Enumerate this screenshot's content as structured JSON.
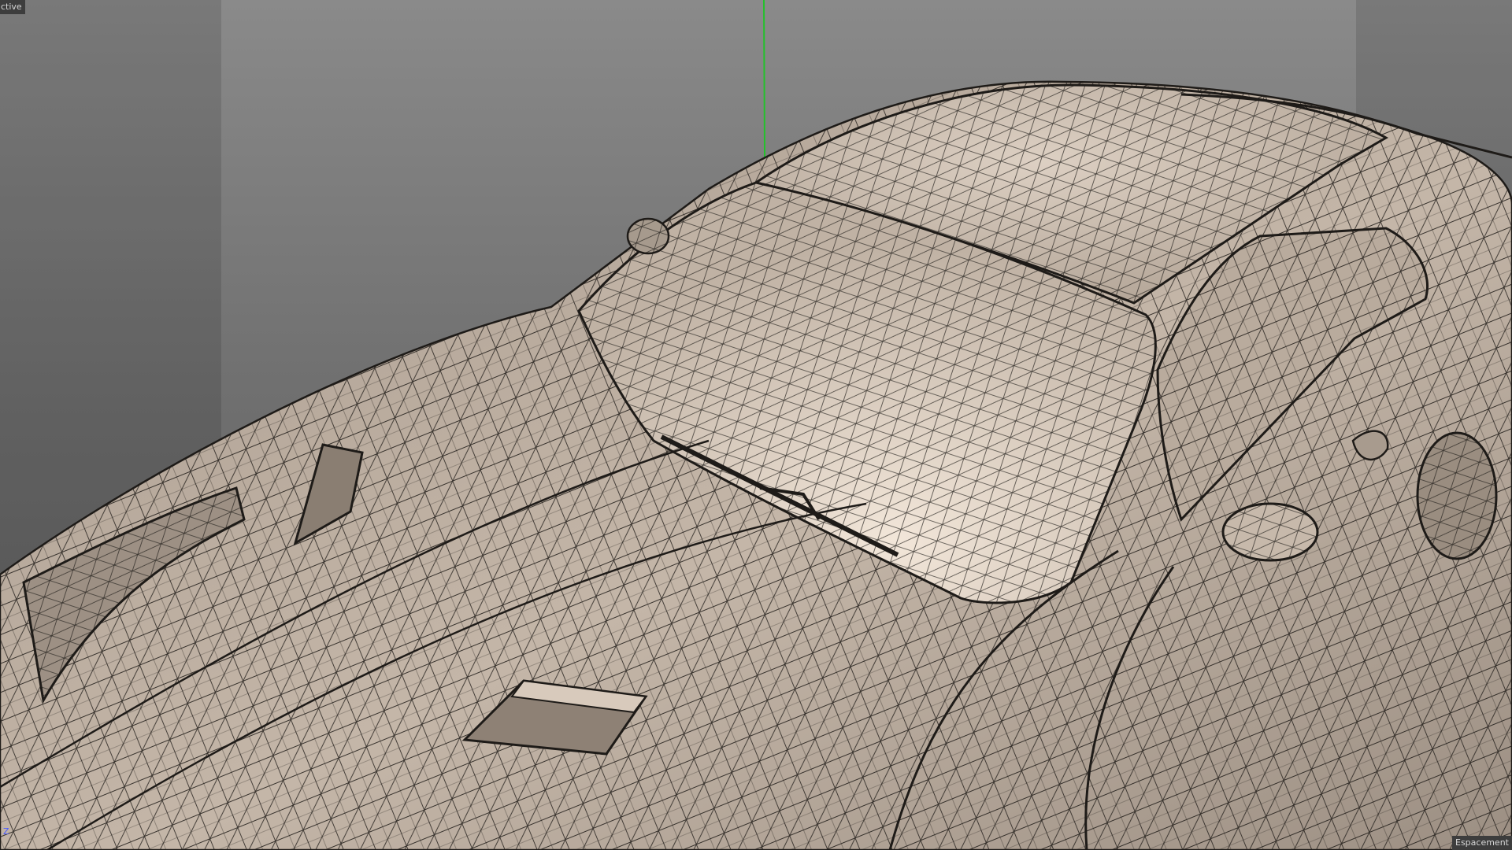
{
  "viewport": {
    "camera_label": "ctive",
    "status_label": "Espacement",
    "axis_label": "Z",
    "object_icon": "car-wireframe-model",
    "colors": {
      "background_top": "#8a8a8a",
      "background_bottom": "#5a5a5a",
      "surface": "#bfb1a4",
      "surface_highlight": "#eadfd3",
      "wire": "#1e1b18",
      "y_axis": "#22c22a"
    }
  }
}
